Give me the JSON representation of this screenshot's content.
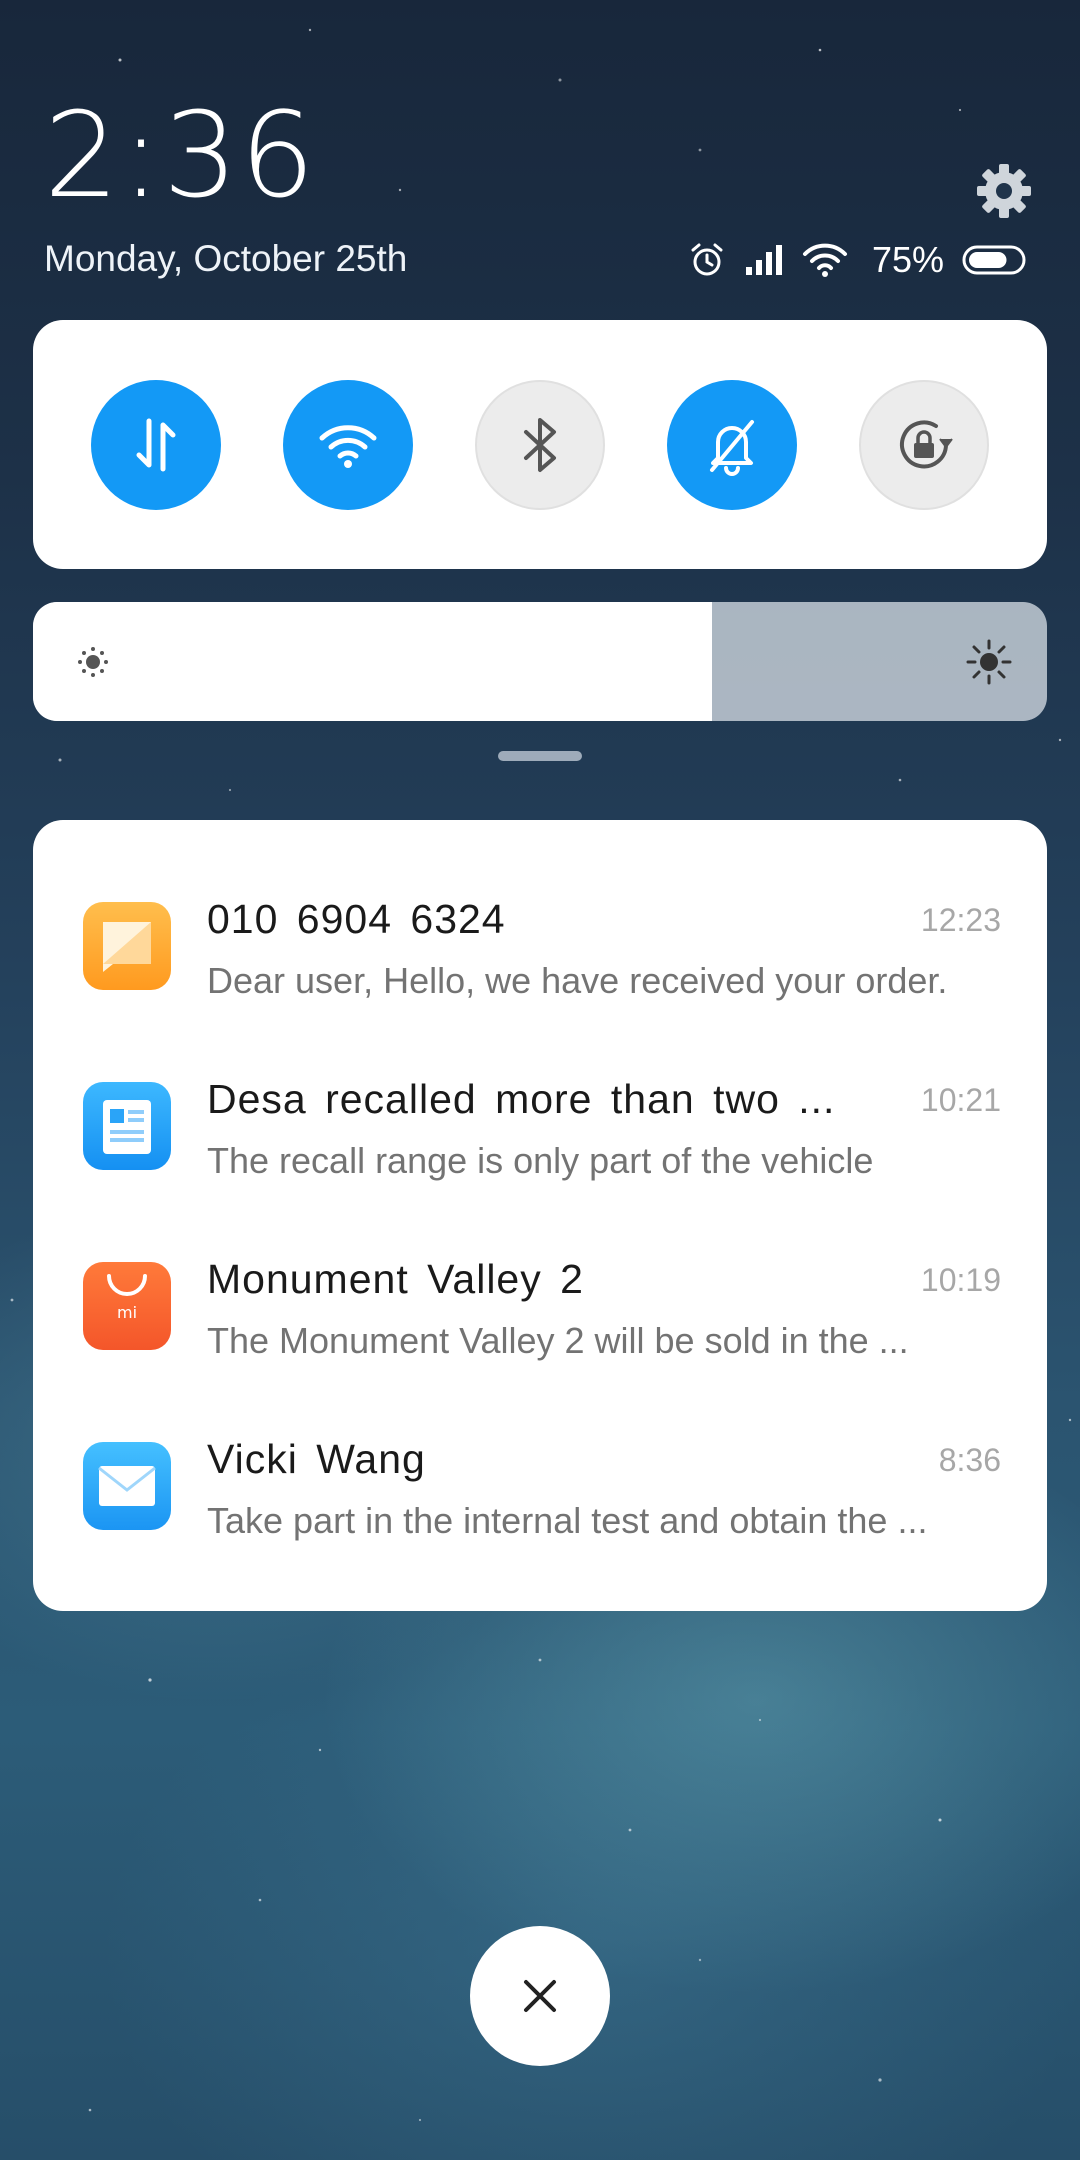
{
  "header": {
    "time": "2:36",
    "date": "Monday, October 25th"
  },
  "status_bar": {
    "battery_percent": "75%",
    "battery_level": 0.75,
    "icons": [
      "alarm-icon",
      "cellular-signal-icon",
      "wifi-icon",
      "battery-icon"
    ]
  },
  "quick_toggles": [
    {
      "name": "mobile-data",
      "icon": "data-transfer-icon",
      "enabled": true
    },
    {
      "name": "wifi",
      "icon": "wifi-icon",
      "enabled": true
    },
    {
      "name": "bluetooth",
      "icon": "bluetooth-icon",
      "enabled": false
    },
    {
      "name": "silent",
      "icon": "bell-muted-icon",
      "enabled": true
    },
    {
      "name": "rotation-lock",
      "icon": "rotation-lock-icon",
      "enabled": false
    }
  ],
  "brightness": {
    "level": 0.67
  },
  "notifications": [
    {
      "title": "010 6904 6324",
      "time": "12:23",
      "body": "Dear user, Hello, we have received your order.",
      "app_icon": "messages-icon"
    },
    {
      "title": "Desa recalled more than two ...",
      "time": "10:21",
      "body": "The recall range is only part of the vehicle",
      "app_icon": "news-icon"
    },
    {
      "title": "Monument Valley 2",
      "time": "10:19",
      "body": "The Monument Valley 2 will be sold in the ...",
      "app_icon": "app-store-icon"
    },
    {
      "title": "Vicki Wang",
      "time": "8:36",
      "body": "Take part in the internal test and obtain the ...",
      "app_icon": "mail-icon"
    }
  ],
  "colors": {
    "accent": "#1399F6",
    "toggle_off": "#ECECEC",
    "time_text": "#A7A7A7",
    "body_text": "#737373"
  }
}
